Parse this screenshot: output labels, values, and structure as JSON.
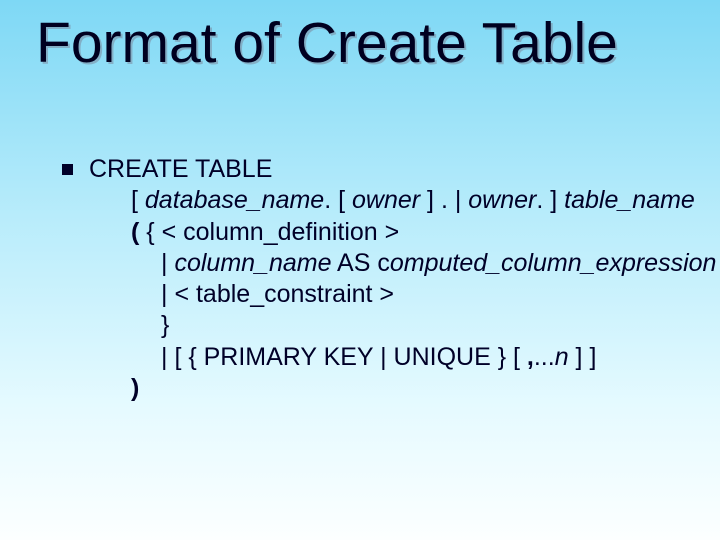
{
  "title": "Format of Create Table",
  "syntax": {
    "line1_create": "CREATE TABLE",
    "line2_pre": "[ ",
    "line2_db": "database_name",
    "line2_mid1": ". [ ",
    "line2_owner1": "owner",
    "line2_mid2": " ] . | ",
    "line2_owner2": "owner",
    "line2_mid3": ". ] ",
    "line2_tbl": "table_name",
    "line3_paren": "( ",
    "line3_rest": "{ < column_definition >",
    "line4_pre": "| ",
    "line4_col": "column_name",
    "line4_as": " AS c",
    "line4_expr": "omputed_column_expression",
    "line5": "| < table_constraint >",
    "line6": "}",
    "line7_pre": "| [ { PRIMARY KEY | UNIQUE } [ ",
    "line7_comma": ",",
    "line7_dots": "...",
    "line7_n": "n",
    "line7_post": " ] ]",
    "line8_paren": ")"
  }
}
